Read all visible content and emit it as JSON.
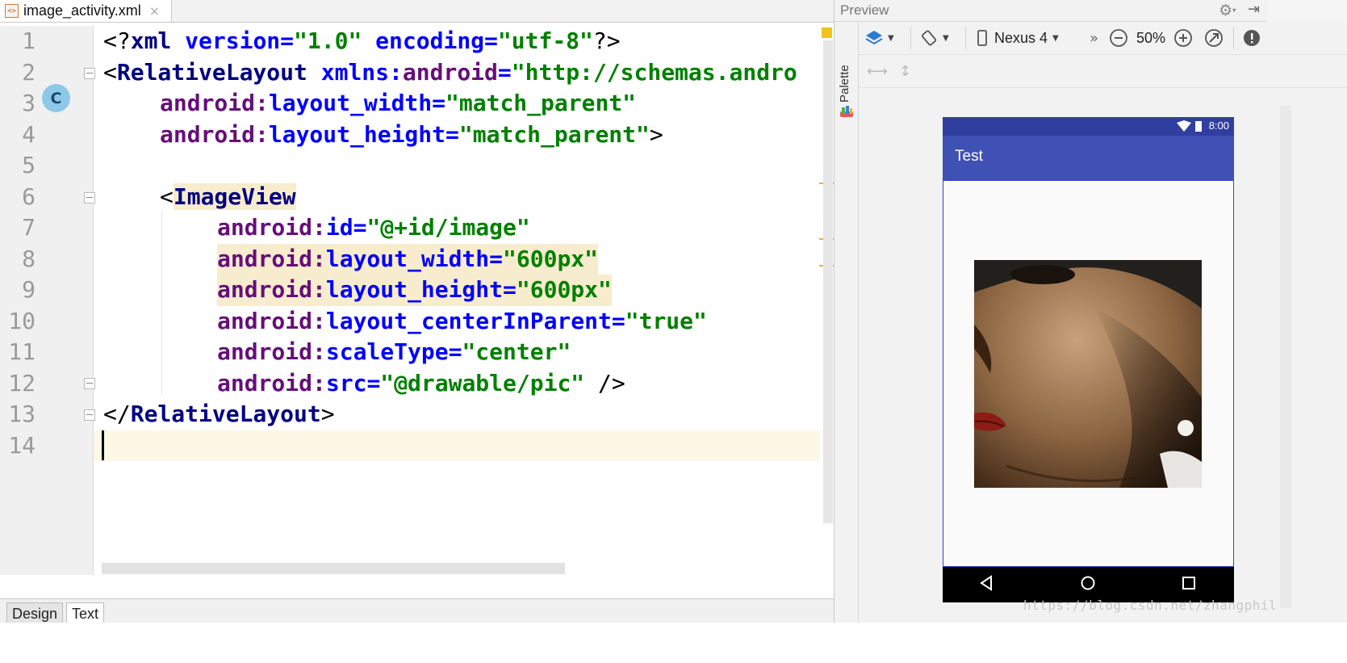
{
  "editor": {
    "file_tab": {
      "label": "image_activity.xml",
      "close": "×",
      "icon": "xml-file-icon"
    },
    "gutter_badge": "C",
    "lines": [
      {
        "n": "1"
      },
      {
        "n": "2"
      },
      {
        "n": "3"
      },
      {
        "n": "4"
      },
      {
        "n": "5"
      },
      {
        "n": "6"
      },
      {
        "n": "7"
      },
      {
        "n": "8"
      },
      {
        "n": "9"
      },
      {
        "n": "10"
      },
      {
        "n": "11"
      },
      {
        "n": "12"
      },
      {
        "n": "13"
      },
      {
        "n": "14"
      }
    ],
    "code": {
      "l1": {
        "a": "<?",
        "b": "xml",
        "c": " version",
        "d": "=",
        "e": "\"1.0\"",
        "f": " encoding",
        "g": "=",
        "h": "\"utf-8\"",
        "i": "?>"
      },
      "l2": {
        "a": "<",
        "b": "RelativeLayout",
        "c": " xmlns:",
        "d": "android",
        "e": "=",
        "f": "\"http://schemas.andro"
      },
      "l3": {
        "ns": "android:",
        "attr": "layout_width",
        "eq": "=",
        "val": "\"match_parent\""
      },
      "l4": {
        "ns": "android:",
        "attr": "layout_height",
        "eq": "=",
        "val": "\"match_parent\"",
        "end": ">"
      },
      "l6": {
        "a": "<",
        "b": "ImageView"
      },
      "l7": {
        "ns": "android:",
        "attr": "id",
        "eq": "=",
        "val": "\"@+id/image\""
      },
      "l8": {
        "ns": "android:",
        "attr": "layout_width",
        "eq": "=",
        "val": "\"600px\""
      },
      "l9": {
        "ns": "android:",
        "attr": "layout_height",
        "eq": "=",
        "val": "\"600px\""
      },
      "l10": {
        "ns": "android:",
        "attr": "layout_centerInParent",
        "eq": "=",
        "val": "\"true\""
      },
      "l11": {
        "ns": "android:",
        "attr": "scaleType",
        "eq": "=",
        "val": "\"center\""
      },
      "l12": {
        "ns": "android:",
        "attr": "src",
        "eq": "=",
        "val": "\"@drawable/pic\"",
        "end": " />"
      },
      "l13": {
        "a": "</",
        "b": "RelativeLayout",
        "c": ">"
      }
    },
    "bottom_tabs": {
      "design": "Design",
      "text": "Text"
    }
  },
  "preview": {
    "title": "Preview",
    "palette_label": "Palette",
    "device": "Nexus 4",
    "zoom": "50%",
    "overflow": "»",
    "icons": [
      "layers-icon",
      "rotate-icon",
      "phone-icon",
      "zoom-out-icon",
      "zoom-in-icon",
      "zoom-fit-icon",
      "warning-icon",
      "gear-icon",
      "pin-icon"
    ],
    "phone": {
      "time": "8:00",
      "app_title": "Test",
      "colors": {
        "status": "#303f9f",
        "appbar": "#3f51b5"
      }
    }
  },
  "watermark": "https://blog.csdn.net/zhangphil"
}
